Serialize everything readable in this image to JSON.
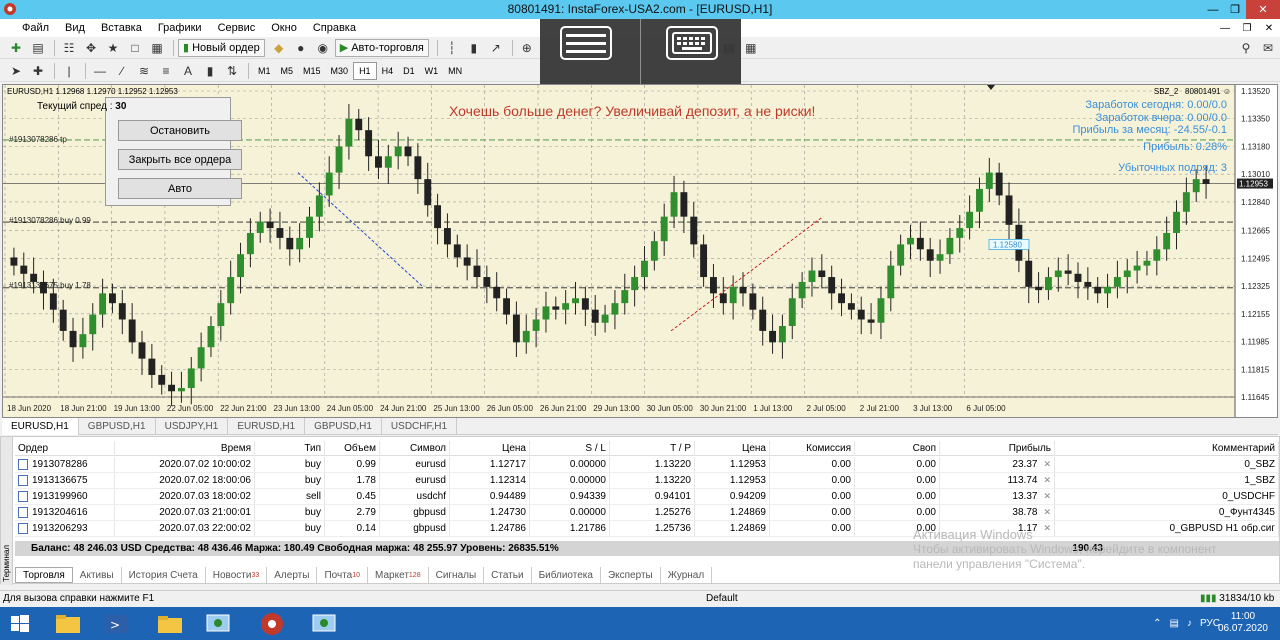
{
  "window": {
    "title": "80801491: InstaForex-USA2.com - [EURUSD,H1]"
  },
  "menu": [
    "Файл",
    "Вид",
    "Вставка",
    "Графики",
    "Сервис",
    "Окно",
    "Справка"
  ],
  "toolbar": {
    "new_order": "Новый ордер",
    "auto_trading": "Авто-торговля"
  },
  "timeframes": [
    "M1",
    "M5",
    "M15",
    "M30",
    "H1",
    "H4",
    "D1",
    "W1",
    "MN"
  ],
  "timeframe_selected": "H1",
  "chart": {
    "info": "EURUSD,H1  1.12968 1.12970 1.12952 1.12953",
    "expert": "SBZ_2",
    "account": "80801491",
    "banner": "Хочешь больше денег? Увеличивай депозит, а не риски!",
    "earn_today": "Заработок сегодня: 0.00/0.0",
    "earn_yesterday": "Заработок вчера: 0.00/0.0",
    "profit_month": "Прибыль за месяц: -24.55/-0.1",
    "profit": "Прибыль: 0.28%",
    "loss_streak": "Убыточных подряд: 3",
    "order_labels": [
      "#1913078286 tp",
      "#1913078286 buy 0.99",
      "#1913136675 buy 1.78"
    ],
    "price_marker": "1.12580",
    "current_price": "1.12953"
  },
  "panel": {
    "spread_label": "Текущий спред :",
    "spread_value": "30",
    "stop": "Остановить",
    "close_all": "Закрыть все ордера",
    "auto": "Авто"
  },
  "chart_data": {
    "type": "candlestick",
    "yticks": [
      "1.13520",
      "1.13350",
      "1.13180",
      "1.13010",
      "1.12840",
      "1.12665",
      "1.12495",
      "1.12325",
      "1.12155",
      "1.11985",
      "1.11815",
      "1.11645"
    ],
    "xticks": [
      "18 Jun 2020",
      "18 Jun 21:00",
      "19 Jun 13:00",
      "22 Jun 05:00",
      "22 Jun 21:00",
      "23 Jun 13:00",
      "24 Jun 05:00",
      "24 Jun 21:00",
      "25 Jun 13:00",
      "26 Jun 05:00",
      "26 Jun 21:00",
      "29 Jun 13:00",
      "30 Jun 05:00",
      "30 Jun 21:00",
      "1 Jul 13:00",
      "2 Jul 05:00",
      "2 Jul 21:00",
      "3 Jul 13:00",
      "6 Jul 05:00"
    ],
    "ylim": [
      1.11645,
      1.1352
    ],
    "close": [
      1.1245,
      1.124,
      1.1235,
      1.1228,
      1.1218,
      1.1205,
      1.1195,
      1.1203,
      1.1215,
      1.1228,
      1.1222,
      1.1212,
      1.1198,
      1.1188,
      1.1178,
      1.1172,
      1.1168,
      1.117,
      1.1182,
      1.1195,
      1.1208,
      1.1222,
      1.1238,
      1.1252,
      1.1265,
      1.1272,
      1.1268,
      1.1262,
      1.1255,
      1.1262,
      1.1275,
      1.1288,
      1.1302,
      1.1318,
      1.1335,
      1.1328,
      1.1312,
      1.1305,
      1.1312,
      1.1318,
      1.1312,
      1.1298,
      1.1282,
      1.1268,
      1.1258,
      1.125,
      1.1245,
      1.1238,
      1.1232,
      1.1225,
      1.1215,
      1.1198,
      1.1205,
      1.1212,
      1.122,
      1.1218,
      1.1222,
      1.1225,
      1.1218,
      1.121,
      1.1215,
      1.1222,
      1.123,
      1.1238,
      1.1248,
      1.126,
      1.1275,
      1.129,
      1.1275,
      1.1258,
      1.1238,
      1.1228,
      1.1222,
      1.1232,
      1.1228,
      1.1218,
      1.1205,
      1.1198,
      1.1208,
      1.1225,
      1.1235,
      1.1242,
      1.1238,
      1.1228,
      1.1222,
      1.1218,
      1.1212,
      1.121,
      1.1225,
      1.1245,
      1.1258,
      1.1262,
      1.1255,
      1.1248,
      1.1252,
      1.1262,
      1.1268,
      1.1278,
      1.1292,
      1.1302,
      1.1288,
      1.127,
      1.1248,
      1.1232,
      1.123,
      1.1238,
      1.1242,
      1.124,
      1.1235,
      1.1232,
      1.1228,
      1.1232,
      1.1238,
      1.1242,
      1.1245,
      1.1248,
      1.1255,
      1.1265,
      1.1278,
      1.129,
      1.1298,
      1.1295
    ]
  },
  "tabs": [
    "EURUSD,H1",
    "GBPUSD,H1",
    "USDJPY,H1",
    "EURUSD,H1",
    "GBPUSD,H1",
    "USDCHF,H1"
  ],
  "terminal": {
    "side_label": "Терминал",
    "columns": [
      "Ордер",
      "Время",
      "Тип",
      "Объем",
      "Символ",
      "Цена",
      "S / L",
      "T / P",
      "Цена",
      "Комиссия",
      "Своп",
      "Прибыль",
      "Комментарий"
    ],
    "rows": [
      [
        "1913078286",
        "2020.07.02 10:00:02",
        "buy",
        "0.99",
        "eurusd",
        "1.12717",
        "0.00000",
        "1.13220",
        "1.12953",
        "0.00",
        "0.00",
        "23.37",
        "0_SBZ"
      ],
      [
        "1913136675",
        "2020.07.02 18:00:06",
        "buy",
        "1.78",
        "eurusd",
        "1.12314",
        "0.00000",
        "1.13220",
        "1.12953",
        "0.00",
        "0.00",
        "113.74",
        "1_SBZ"
      ],
      [
        "1913199960",
        "2020.07.03 18:00:02",
        "sell",
        "0.45",
        "usdchf",
        "0.94489",
        "0.94339",
        "0.94101",
        "0.94209",
        "0.00",
        "0.00",
        "13.37",
        "0_USDCHF"
      ],
      [
        "1913204616",
        "2020.07.03 21:00:01",
        "buy",
        "2.79",
        "gbpusd",
        "1.24730",
        "0.00000",
        "1.25276",
        "1.24869",
        "0.00",
        "0.00",
        "38.78",
        "0_Фунт4345"
      ],
      [
        "1913206293",
        "2020.07.03 22:00:02",
        "buy",
        "0.14",
        "gbpusd",
        "1.24786",
        "1.21786",
        "1.25736",
        "1.24869",
        "0.00",
        "0.00",
        "1.17",
        "0_GBPUSD H1 обр.сиг"
      ]
    ],
    "balance": "Баланс: 48 246.03 USD  Средства: 48 436.46  Маржа: 180.49  Свободная маржа: 48 255.97  Уровень: 26835.51%",
    "balance_total": "190.43",
    "tabs": [
      {
        "label": "Торговля",
        "badge": ""
      },
      {
        "label": "Активы",
        "badge": ""
      },
      {
        "label": "История Счета",
        "badge": ""
      },
      {
        "label": "Новости",
        "badge": "33"
      },
      {
        "label": "Алерты",
        "badge": ""
      },
      {
        "label": "Почта",
        "badge": "10"
      },
      {
        "label": "Маркет",
        "badge": "128"
      },
      {
        "label": "Сигналы",
        "badge": ""
      },
      {
        "label": "Статьи",
        "badge": ""
      },
      {
        "label": "Библиотека",
        "badge": ""
      },
      {
        "label": "Эксперты",
        "badge": ""
      },
      {
        "label": "Журнал",
        "badge": ""
      }
    ]
  },
  "watermark": {
    "line1": "Активация Windows",
    "line2": "Чтобы активировать Windows, перейдите в компонент",
    "line3": "панели управления \"Система\"."
  },
  "status": {
    "help": "Для вызова справки нажмите F1",
    "profile": "Default",
    "traffic": "31834/10 kb"
  },
  "tray": {
    "lang": "РУС",
    "time": "11:00",
    "date": "06.07.2020"
  }
}
